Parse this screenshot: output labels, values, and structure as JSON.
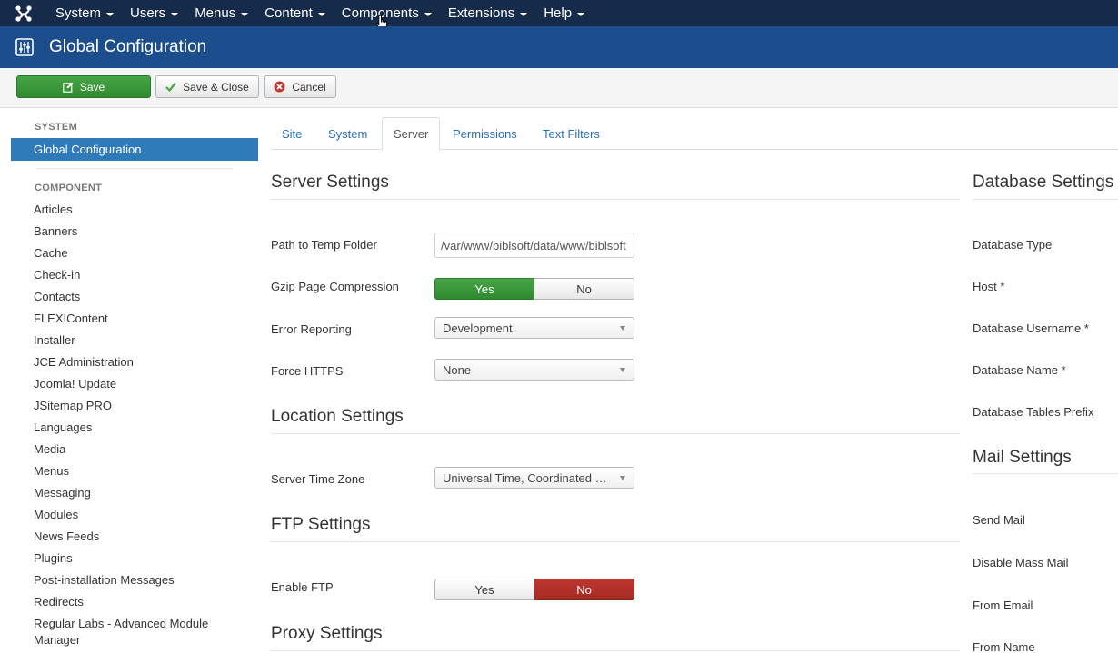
{
  "navbar": {
    "logo_icon": "joomla-logo-icon",
    "menu": [
      {
        "label": "System"
      },
      {
        "label": "Users"
      },
      {
        "label": "Menus"
      },
      {
        "label": "Content"
      },
      {
        "label": "Components"
      },
      {
        "label": "Extensions"
      },
      {
        "label": "Help"
      }
    ]
  },
  "header": {
    "icon": "sliders-icon",
    "title": "Global Configuration"
  },
  "toolbar": {
    "save_label": "Save",
    "save_close_label": "Save & Close",
    "cancel_label": "Cancel"
  },
  "sidebar": {
    "system_heading": "SYSTEM",
    "active_item": "Global Configuration",
    "component_heading": "COMPONENT",
    "items": [
      "Articles",
      "Banners",
      "Cache",
      "Check-in",
      "Contacts",
      "FLEXIContent",
      "Installer",
      "JCE Administration",
      "Joomla! Update",
      "JSitemap PRO",
      "Languages",
      "Media",
      "Menus",
      "Messaging",
      "Modules",
      "News Feeds",
      "Plugins",
      "Post-installation Messages",
      "Redirects",
      "Regular Labs - Advanced Module Manager"
    ]
  },
  "tabs": [
    {
      "label": "Site",
      "active": false
    },
    {
      "label": "System",
      "active": false
    },
    {
      "label": "Server",
      "active": true
    },
    {
      "label": "Permissions",
      "active": false
    },
    {
      "label": "Text Filters",
      "active": false
    }
  ],
  "server_settings": {
    "title": "Server Settings",
    "temp_path_label": "Path to Temp Folder",
    "temp_path_value": "/var/www/biblsoft/data/www/biblsoft",
    "gzip_label": "Gzip Page Compression",
    "gzip_yes": "Yes",
    "gzip_no": "No",
    "error_label": "Error Reporting",
    "error_value": "Development",
    "https_label": "Force HTTPS",
    "https_value": "None"
  },
  "location_settings": {
    "title": "Location Settings",
    "tz_label": "Server Time Zone",
    "tz_value": "Universal Time, Coordinated (UTC)"
  },
  "ftp_settings": {
    "title": "FTP Settings",
    "enable_label": "Enable FTP",
    "yes": "Yes",
    "no": "No"
  },
  "proxy_settings": {
    "title": "Proxy Settings"
  },
  "database_settings": {
    "title": "Database Settings",
    "type_label": "Database Type",
    "host_label": "Host *",
    "user_label": "Database Username *",
    "name_label": "Database Name *",
    "prefix_label": "Database Tables Prefix"
  },
  "mail_settings": {
    "title": "Mail Settings",
    "send_label": "Send Mail",
    "mass_label": "Disable Mass Mail",
    "from_email_label": "From Email",
    "from_name_label": "From Name"
  },
  "colors": {
    "navbar": "#162a4a",
    "header": "#1c4d8c",
    "active_blue": "#2f7ab9",
    "success": "#46a546",
    "danger": "#bd362f",
    "link": "#2a6ebb"
  }
}
